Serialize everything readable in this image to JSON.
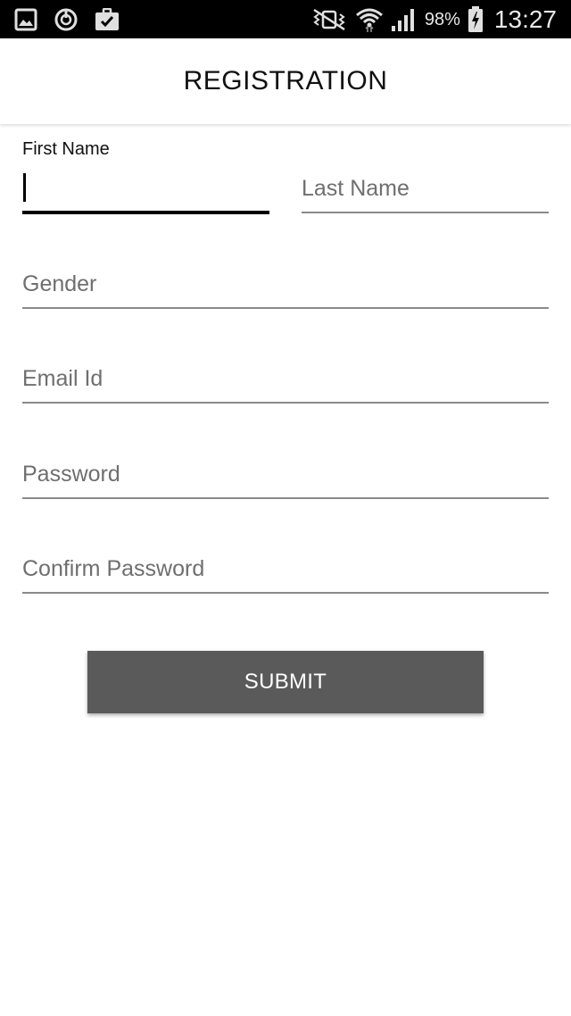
{
  "status_bar": {
    "icons_left": [
      "gallery-icon",
      "power-sync-icon",
      "briefcase-check-icon"
    ],
    "icons_right": [
      "vibrate-mute-icon",
      "wifi-icon",
      "signal-icon",
      "battery-charging-icon"
    ],
    "battery": "98%",
    "time": "13:27"
  },
  "app_bar": {
    "title": "REGISTRATION"
  },
  "form": {
    "first_name": {
      "label": "First Name",
      "value": ""
    },
    "last_name": {
      "placeholder": "Last Name",
      "value": ""
    },
    "gender": {
      "placeholder": "Gender",
      "value": ""
    },
    "email": {
      "placeholder": "Email Id",
      "value": ""
    },
    "password": {
      "placeholder": "Password",
      "value": ""
    },
    "confirm_password": {
      "placeholder": "Confirm Password",
      "value": ""
    },
    "submit_label": "SUBMIT"
  },
  "colors": {
    "status_bar_bg": "#000000",
    "button_bg": "#5a5a5a",
    "focused_line": "#000000",
    "inactive_line": "#8a8a8a",
    "placeholder_text": "#6f6f6f"
  }
}
